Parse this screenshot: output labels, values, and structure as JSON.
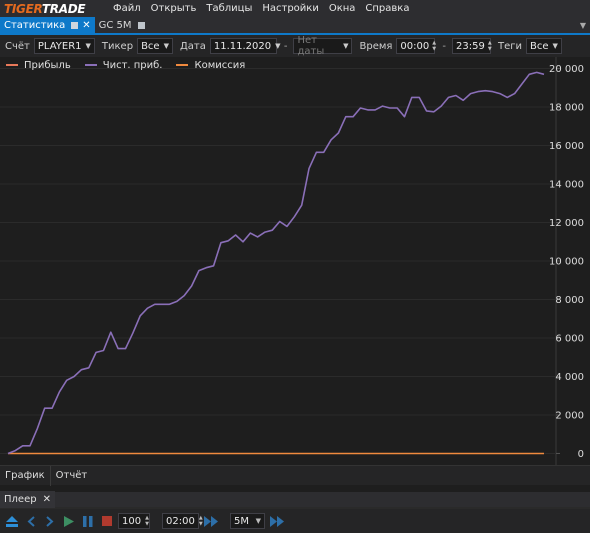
{
  "app": {
    "logo_part1": "TIGER",
    "logo_part2": "TRADE"
  },
  "menu": [
    "Файл",
    "Открыть",
    "Таблицы",
    "Настройки",
    "Окна",
    "Справка"
  ],
  "tabs": [
    {
      "label": "Статистика",
      "active": true
    },
    {
      "label": "GC 5M",
      "active": false
    }
  ],
  "filters": {
    "account_label": "Счёт",
    "account_value": "PLAYER1",
    "ticker_label": "Тикер",
    "ticker_value": "Все",
    "date_label": "Дата",
    "date_from": "11.11.2020",
    "date_sep": "-",
    "date_to": "Нет даты",
    "time_label": "Время",
    "time_from": "00:00",
    "time_sep": "-",
    "time_to": "23:59",
    "tags_label": "Теги",
    "tags_value": "Все"
  },
  "colors": {
    "accent": "#0e79c9",
    "profit": "#e8795a",
    "net_profit": "#8a6fb8",
    "commission": "#f08a3e"
  },
  "chart_data": {
    "type": "line",
    "ylim": [
      -600,
      20600
    ],
    "yticks": [
      0,
      2000,
      4000,
      6000,
      8000,
      10000,
      12000,
      14000,
      16000,
      18000,
      20000
    ],
    "ytick_labels": [
      "0",
      "2 000",
      "4 000",
      "6 000",
      "8 000",
      "10 000",
      "12 000",
      "14 000",
      "16 000",
      "18 000",
      "20 000"
    ],
    "series": [
      {
        "name": "Прибыль",
        "values": []
      },
      {
        "name": "Чист. приб.",
        "values": [
          0,
          150,
          400,
          400,
          1300,
          2350,
          2350,
          3200,
          3800,
          4000,
          4350,
          4450,
          5250,
          5350,
          6300,
          5450,
          5450,
          6250,
          7150,
          7550,
          7750,
          7750,
          7750,
          7900,
          8200,
          8700,
          9500,
          9650,
          9750,
          10950,
          11050,
          11350,
          11000,
          11450,
          11250,
          11500,
          11600,
          12050,
          11800,
          12300,
          12900,
          14800,
          15650,
          15650,
          16300,
          16650,
          17500,
          17500,
          17950,
          17850,
          17850,
          18050,
          17950,
          17950,
          17500,
          18500,
          18500,
          17800,
          17750,
          18050,
          18500,
          18600,
          18350,
          18700,
          18800,
          18850,
          18800,
          18700,
          18500,
          18700,
          19200,
          19700,
          19800,
          19700
        ]
      },
      {
        "name": "Комиссия",
        "values": [
          0
        ]
      }
    ]
  },
  "bottom_tabs": [
    "График",
    "Отчёт"
  ],
  "player": {
    "tab_label": "Плеер",
    "speed": "100",
    "time": "02:00",
    "timeframe": "5M"
  }
}
